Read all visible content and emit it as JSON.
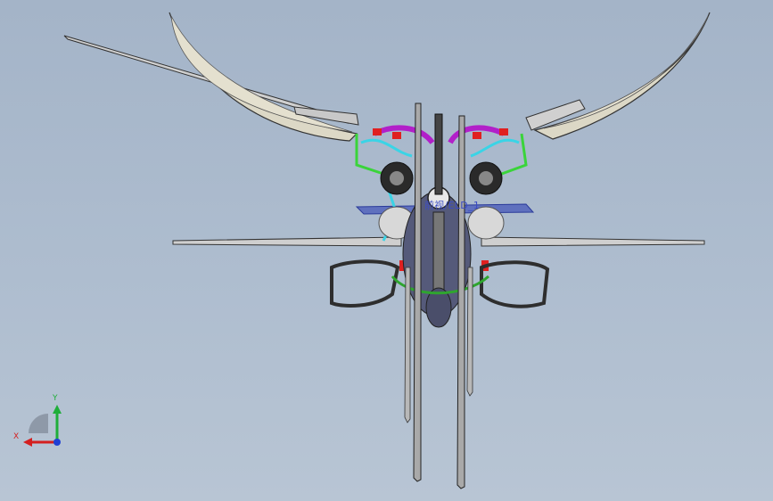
{
  "viewport": {
    "background_top": "#a4b4c8",
    "background_bottom": "#b8c5d4",
    "model_name": "",
    "plane_label": "前视/ELD_1"
  },
  "triad": {
    "x_label": "X",
    "y_label": "Y",
    "x_color": "#d41f1f",
    "y_color": "#1fae3a",
    "z_color": "#1f3fd4"
  },
  "colors": {
    "wing_fill": "#dcd8c6",
    "frame_line": "#3a3a3a",
    "accent_magenta": "#b21fc9",
    "accent_cyan": "#3ad4e6",
    "accent_green": "#3ad43a",
    "accent_red": "#e02020",
    "plane_blue": "#3b4cc4"
  },
  "icons": [
    "coordinate-triad-icon"
  ]
}
